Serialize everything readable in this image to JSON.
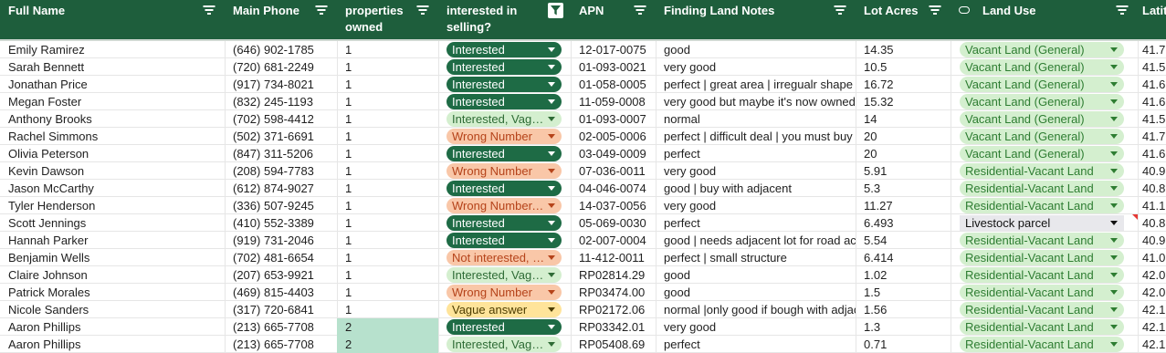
{
  "columns": {
    "full_name": "Full Name",
    "main_phone": "Main Phone",
    "properties_owned_1": "properties",
    "properties_owned_2": "owned",
    "interested_1": "interested in",
    "interested_2": "selling?",
    "apn": "APN",
    "notes": "Finding Land Notes",
    "lot_acres": "Lot Acres",
    "land_use": "Land Use",
    "latitude": "Latit"
  },
  "colors": {
    "header_bg": "#1e5e3c",
    "interested": "#1e6b45",
    "wrong_number": "#f9c7a8",
    "vague": "#ffe49a",
    "land_use_chip": "#d4efcf",
    "highlight": "#b7e1cd"
  },
  "rows": [
    {
      "name": "Emily Ramirez",
      "phone": "(646) 902-1785",
      "props": "1",
      "interest": "Interested",
      "apn": "12-017-0075",
      "notes": "good",
      "lot": "14.35",
      "use": "Vacant Land (General)",
      "lat": "41.7"
    },
    {
      "name": "Sarah Bennett",
      "phone": "(720) 681-2249",
      "props": "1",
      "interest": "Interested",
      "apn": "01-093-0021",
      "notes": "very good",
      "lot": "10.5",
      "use": "Vacant Land (General)",
      "lat": "41.5"
    },
    {
      "name": "Jonathan Price",
      "phone": "(917) 734-8021",
      "props": "1",
      "interest": "Interested",
      "apn": "01-058-0005",
      "notes": "perfect | great area | irregualr shape",
      "lot": "16.72",
      "use": "Vacant Land (General)",
      "lat": "41.6"
    },
    {
      "name": "Megan Foster",
      "phone": "(832) 245-1193",
      "props": "1",
      "interest": "Interested",
      "apn": "11-059-0008",
      "notes": "very good but maybe it's now owned",
      "lot": "15.32",
      "use": "Vacant Land (General)",
      "lat": "41.6"
    },
    {
      "name": "Anthony Brooks",
      "phone": "(702) 598-4412",
      "props": "1",
      "interest": "Interested, Vague answer",
      "apn": "01-093-0007",
      "notes": "normal",
      "lot": "14",
      "use": "Vacant Land (General)",
      "lat": "41.5"
    },
    {
      "name": "Rachel Simmons",
      "phone": "(502) 371-6691",
      "props": "1",
      "interest": "Wrong Number",
      "apn": "02-005-0006",
      "notes": "perfect | difficult deal | you must buy",
      "lot": "20",
      "use": "Vacant Land (General)",
      "lat": "41.7"
    },
    {
      "name": "Olivia Peterson",
      "phone": "(847) 311-5206",
      "props": "1",
      "interest": "Interested",
      "apn": "03-049-0009",
      "notes": "perfect",
      "lot": "20",
      "use": "Vacant Land (General)",
      "lat": "41.6"
    },
    {
      "name": "Kevin Dawson",
      "phone": "(208) 594-7783",
      "props": "1",
      "interest": "Wrong Number",
      "apn": "07-036-0011",
      "notes": "very good",
      "lot": "5.91",
      "use": "Residential-Vacant Land",
      "lat": "40.9"
    },
    {
      "name": "Jason McCarthy",
      "phone": "(612) 874-9027",
      "props": "1",
      "interest": "Interested",
      "apn": "04-046-0074",
      "notes": "good | buy with adjacent",
      "lot": "5.3",
      "use": "Residential-Vacant Land",
      "lat": "40.8"
    },
    {
      "name": "Tyler Henderson",
      "phone": "(336) 507-9245",
      "props": "1",
      "interest": "Wrong Number, Vague answer",
      "apn": "14-037-0056",
      "notes": "very good",
      "lot": "11.27",
      "use": "Residential-Vacant Land",
      "lat": "41.1"
    },
    {
      "name": "Scott Jennings",
      "phone": "(410) 552-3389",
      "props": "1",
      "interest": "Interested",
      "apn": "05-069-0030",
      "notes": "perfect",
      "lot": "6.493",
      "use": "Livestock parcel",
      "lat": "40.8"
    },
    {
      "name": "Hannah Parker",
      "phone": "(919) 731-2046",
      "props": "1",
      "interest": "Interested",
      "apn": "02-007-0004",
      "notes": "good | needs adjacent lot for road access",
      "lot": "5.54",
      "use": "Residential-Vacant Land",
      "lat": "40.9"
    },
    {
      "name": "Benjamin Wells",
      "phone": "(702) 481-6654",
      "props": "1",
      "interest": "Not interested, Wrong Number",
      "apn": "11-412-0011",
      "notes": "perfect | small structure",
      "lot": "6.414",
      "use": "Residential-Vacant Land",
      "lat": "41.0"
    },
    {
      "name": "Claire Johnson",
      "phone": "(207) 653-9921",
      "props": "1",
      "interest": "Interested, Vague answer",
      "apn": "RP02814.29",
      "notes": "good",
      "lot": "1.02",
      "use": "Residential-Vacant Land",
      "lat": "42.0"
    },
    {
      "name": "Patrick Morales",
      "phone": "(469) 815-4403",
      "props": "1",
      "interest": "Wrong Number",
      "apn": "RP03474.00",
      "notes": "good",
      "lot": "1.5",
      "use": "Residential-Vacant Land",
      "lat": "42.0"
    },
    {
      "name": "Nicole Sanders",
      "phone": "(317) 720-6841",
      "props": "1",
      "interest": "Vague answer",
      "apn": "RP02172.06",
      "notes": "normal |only good if bough with adjacent",
      "lot": "1.56",
      "use": "Residential-Vacant Land",
      "lat": "42.1"
    },
    {
      "name": "Aaron Phillips",
      "phone": "(213) 665-7708",
      "props": "2",
      "interest": "Interested",
      "apn": "RP03342.01",
      "notes": "very good",
      "lot": "1.3",
      "use": "Residential-Vacant Land",
      "lat": "42.1"
    },
    {
      "name": "Aaron Phillips",
      "phone": "(213) 665-7708",
      "props": "2",
      "interest": "Interested, Vague answer",
      "apn": "RP05408.69",
      "notes": "perfect",
      "lot": "0.71",
      "use": "Residential-Vacant Land",
      "lat": "42.1"
    }
  ]
}
